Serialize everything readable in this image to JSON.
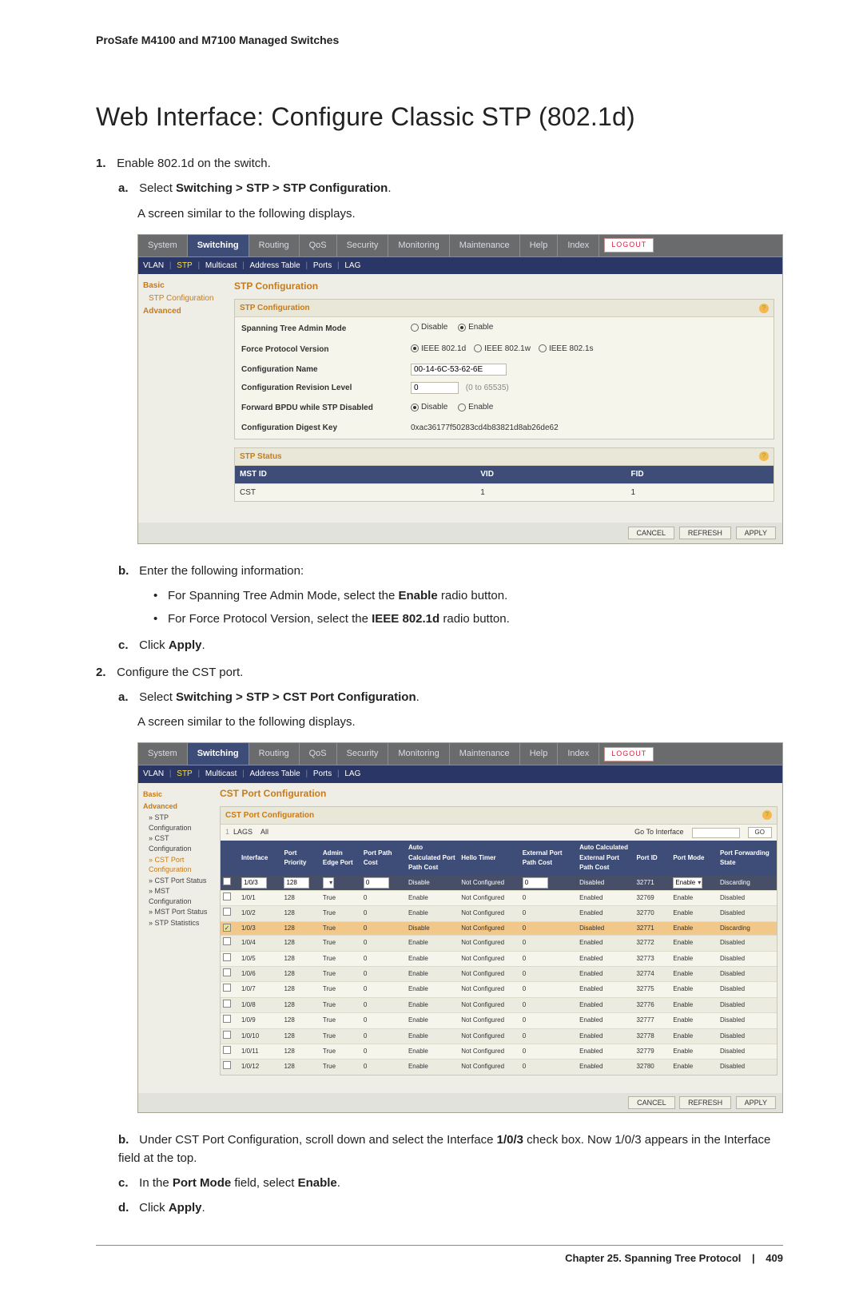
{
  "running_header": "ProSafe M4100 and M7100 Managed Switches",
  "page_title": "Web Interface: Configure Classic STP (802.1d)",
  "steps": {
    "s1": "Enable 802.1d on the switch.",
    "s1a_pre": "Select ",
    "s1a_bold": "Switching > STP > STP Configuration",
    "s1a_post": ".",
    "s1_screen_note": "A screen similar to the following displays.",
    "s1b": "Enter the following information:",
    "s1b_b1_pre": "For Spanning Tree Admin Mode, select the ",
    "s1b_b1_bold": "Enable",
    "s1b_b1_post": " radio button.",
    "s1b_b2_pre": "For Force Protocol Version, select the ",
    "s1b_b2_bold": "IEEE 802.1d",
    "s1b_b2_post": " radio button.",
    "s1c_pre": "Click ",
    "s1c_bold": "Apply",
    "s1c_post": ".",
    "s2": "Configure the CST port.",
    "s2a_pre": "Select ",
    "s2a_bold": "Switching > STP > CST Port Configuration",
    "s2a_post": ".",
    "s2_screen_note": "A screen similar to the following displays.",
    "s2b_pre": "Under CST Port Configuration, scroll down and select the Interface ",
    "s2b_bold": "1/0/3",
    "s2b_post": " check box. Now 1/0/3 appears in the Interface field at the top.",
    "s2c_pre": "In the ",
    "s2c_bold1": "Port Mode",
    "s2c_mid": " field, select ",
    "s2c_bold2": "Enable",
    "s2c_post": ".",
    "s2d_pre": "Click ",
    "s2d_bold": "Apply",
    "s2d_post": "."
  },
  "ui1": {
    "tabs": [
      "System",
      "Switching",
      "Routing",
      "QoS",
      "Security",
      "Monitoring",
      "Maintenance",
      "Help",
      "Index"
    ],
    "active_tab_index": 1,
    "logout": "LOGOUT",
    "subtabs": [
      "VLAN",
      "STP",
      "Multicast",
      "Address Table",
      "Ports",
      "LAG"
    ],
    "subtab_sel_index": 1,
    "side": {
      "basic": "Basic",
      "basic_item": "STP Configuration",
      "advanced": "Advanced"
    },
    "title": "STP Configuration",
    "panel1_title": "STP Configuration",
    "rows": {
      "admin_mode": {
        "label": "Spanning Tree Admin Mode",
        "disable": "Disable",
        "enable": "Enable",
        "selected": "Enable"
      },
      "force_proto": {
        "label": "Force Protocol Version",
        "opts": [
          "IEEE 802.1d",
          "IEEE 802.1w",
          "IEEE 802.1s"
        ],
        "selected": 0
      },
      "cfg_name": {
        "label": "Configuration Name",
        "value": "00-14-6C-53-62-6E"
      },
      "rev_level": {
        "label": "Configuration Revision Level",
        "value": "0",
        "hint": "(0 to 65535)"
      },
      "fwd_bpdu": {
        "label": "Forward BPDU while STP Disabled",
        "disable": "Disable",
        "enable": "Enable",
        "selected": "Disable"
      },
      "digest": {
        "label": "Configuration Digest Key",
        "value": "0xac36177f50283cd4b83821d8ab26de62"
      }
    },
    "panel2_title": "STP Status",
    "status_headers": [
      "MST ID",
      "VID",
      "FID"
    ],
    "status_row": [
      "CST",
      "1",
      "1"
    ],
    "buttons": {
      "cancel": "CANCEL",
      "refresh": "REFRESH",
      "apply": "APPLY"
    }
  },
  "ui2": {
    "tabs": [
      "System",
      "Switching",
      "Routing",
      "QoS",
      "Security",
      "Monitoring",
      "Maintenance",
      "Help",
      "Index"
    ],
    "active_tab_index": 1,
    "logout": "LOGOUT",
    "subtabs": [
      "VLAN",
      "STP",
      "Multicast",
      "Address Table",
      "Ports",
      "LAG"
    ],
    "subtab_sel_index": 1,
    "side": {
      "basic": "Basic",
      "advanced": "Advanced",
      "items": [
        "STP Configuration",
        "CST Configuration",
        "CST Port Configuration",
        "CST Port Status",
        "MST Configuration",
        "MST Port Status",
        "STP Statistics"
      ],
      "selected_index": 2
    },
    "title": "CST Port Configuration",
    "panel_title": "CST Port Configuration",
    "toolbar": {
      "lags": "LAGS",
      "all": "All",
      "goto_label": "Go To Interface",
      "go": "GO"
    },
    "headers": [
      "",
      "Interface",
      "Port Priority",
      "Admin Edge Port",
      "Port Path Cost",
      "Auto Calculated Port Path Cost",
      "Hello Timer",
      "External Port Path Cost",
      "Auto Calculated External Port Path Cost",
      "Port ID",
      "Port Mode",
      "Port Forwarding State"
    ],
    "edit_row": {
      "interface": "1/0/3",
      "priority": "128",
      "edge": "",
      "cost": "0",
      "auto": "Disable",
      "hello": "Not Configured",
      "ext": "0",
      "autoext": "Disabled",
      "portid": "32771",
      "mode": "Enable",
      "fwd": "Discarding"
    },
    "rows": [
      {
        "chk": false,
        "if": "1/0/1",
        "pri": "128",
        "edge": "True",
        "cost": "0",
        "auto": "Enable",
        "hello": "Not Configured",
        "ext": "0",
        "aext": "Enabled",
        "pid": "32769",
        "mode": "Enable",
        "fwd": "Disabled"
      },
      {
        "chk": false,
        "if": "1/0/2",
        "pri": "128",
        "edge": "True",
        "cost": "0",
        "auto": "Enable",
        "hello": "Not Configured",
        "ext": "0",
        "aext": "Enabled",
        "pid": "32770",
        "mode": "Enable",
        "fwd": "Disabled"
      },
      {
        "chk": true,
        "if": "1/0/3",
        "pri": "128",
        "edge": "True",
        "cost": "0",
        "auto": "Disable",
        "hello": "Not Configured",
        "ext": "0",
        "aext": "Disabled",
        "pid": "32771",
        "mode": "Enable",
        "fwd": "Discarding",
        "sel": true
      },
      {
        "chk": false,
        "if": "1/0/4",
        "pri": "128",
        "edge": "True",
        "cost": "0",
        "auto": "Enable",
        "hello": "Not Configured",
        "ext": "0",
        "aext": "Enabled",
        "pid": "32772",
        "mode": "Enable",
        "fwd": "Disabled"
      },
      {
        "chk": false,
        "if": "1/0/5",
        "pri": "128",
        "edge": "True",
        "cost": "0",
        "auto": "Enable",
        "hello": "Not Configured",
        "ext": "0",
        "aext": "Enabled",
        "pid": "32773",
        "mode": "Enable",
        "fwd": "Disabled"
      },
      {
        "chk": false,
        "if": "1/0/6",
        "pri": "128",
        "edge": "True",
        "cost": "0",
        "auto": "Enable",
        "hello": "Not Configured",
        "ext": "0",
        "aext": "Enabled",
        "pid": "32774",
        "mode": "Enable",
        "fwd": "Disabled"
      },
      {
        "chk": false,
        "if": "1/0/7",
        "pri": "128",
        "edge": "True",
        "cost": "0",
        "auto": "Enable",
        "hello": "Not Configured",
        "ext": "0",
        "aext": "Enabled",
        "pid": "32775",
        "mode": "Enable",
        "fwd": "Disabled"
      },
      {
        "chk": false,
        "if": "1/0/8",
        "pri": "128",
        "edge": "True",
        "cost": "0",
        "auto": "Enable",
        "hello": "Not Configured",
        "ext": "0",
        "aext": "Enabled",
        "pid": "32776",
        "mode": "Enable",
        "fwd": "Disabled"
      },
      {
        "chk": false,
        "if": "1/0/9",
        "pri": "128",
        "edge": "True",
        "cost": "0",
        "auto": "Enable",
        "hello": "Not Configured",
        "ext": "0",
        "aext": "Enabled",
        "pid": "32777",
        "mode": "Enable",
        "fwd": "Disabled"
      },
      {
        "chk": false,
        "if": "1/0/10",
        "pri": "128",
        "edge": "True",
        "cost": "0",
        "auto": "Enable",
        "hello": "Not Configured",
        "ext": "0",
        "aext": "Enabled",
        "pid": "32778",
        "mode": "Enable",
        "fwd": "Disabled"
      },
      {
        "chk": false,
        "if": "1/0/11",
        "pri": "128",
        "edge": "True",
        "cost": "0",
        "auto": "Enable",
        "hello": "Not Configured",
        "ext": "0",
        "aext": "Enabled",
        "pid": "32779",
        "mode": "Enable",
        "fwd": "Disabled"
      },
      {
        "chk": false,
        "if": "1/0/12",
        "pri": "128",
        "edge": "True",
        "cost": "0",
        "auto": "Enable",
        "hello": "Not Configured",
        "ext": "0",
        "aext": "Enabled",
        "pid": "32780",
        "mode": "Enable",
        "fwd": "Disabled"
      }
    ],
    "buttons": {
      "cancel": "CANCEL",
      "refresh": "REFRESH",
      "apply": "APPLY"
    }
  },
  "doc_footer": {
    "chapter": "Chapter 25.  Spanning Tree Protocol",
    "page": "409"
  }
}
